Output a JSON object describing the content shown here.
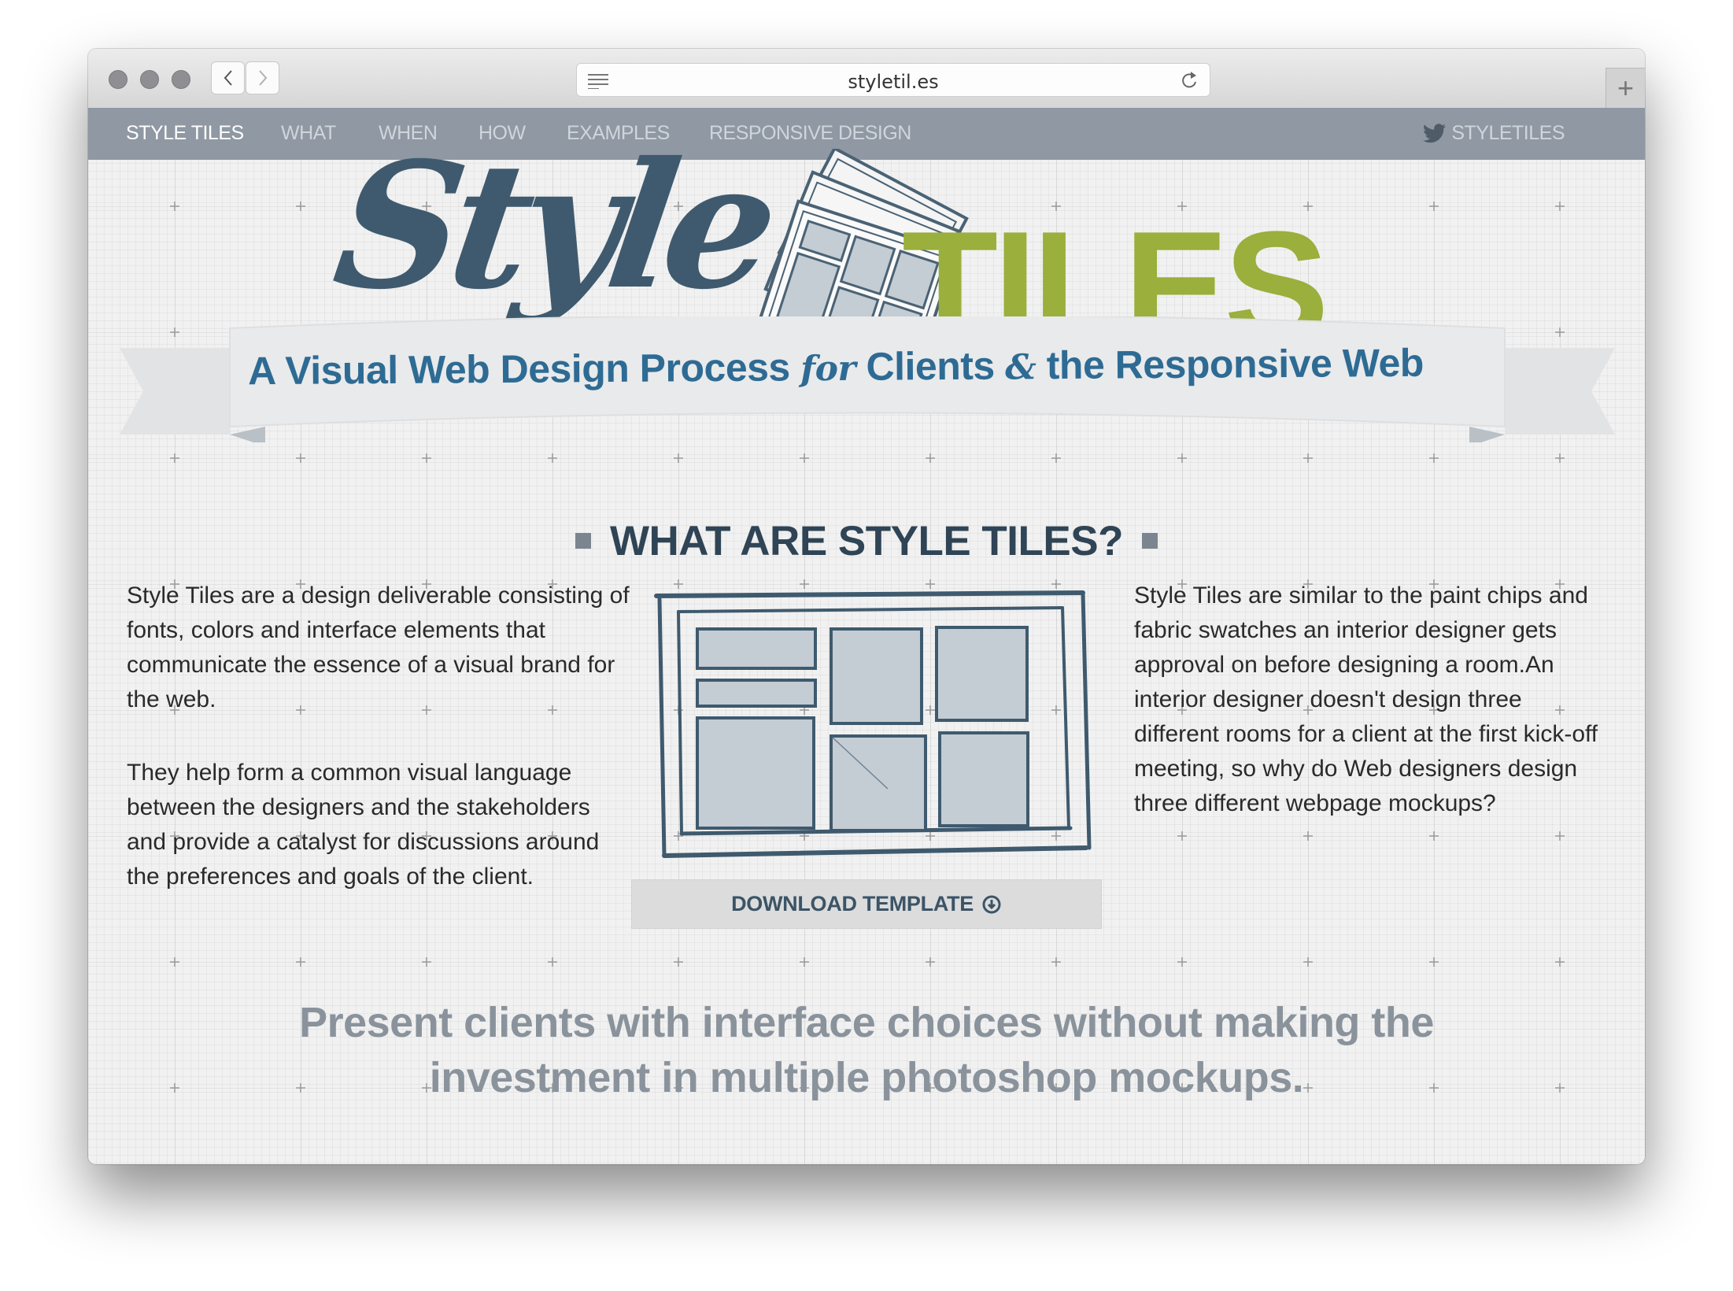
{
  "browser": {
    "url": "styletil.es",
    "traffic_lights": [
      "close",
      "minimize",
      "zoom"
    ],
    "new_tab_label": "+"
  },
  "site_nav": {
    "items": [
      {
        "label": "STYLE TILES",
        "active": true
      },
      {
        "label": "WHAT",
        "active": false
      },
      {
        "label": "WHEN",
        "active": false
      },
      {
        "label": "HOW",
        "active": false
      },
      {
        "label": "EXAMPLES",
        "active": false
      },
      {
        "label": "RESPONSIVE DESIGN",
        "active": false
      }
    ],
    "twitter_label": "STYLETILES"
  },
  "logo": {
    "script_word": "Style",
    "block_word": "TILES",
    "colors": {
      "script": "#3f5a6e",
      "block": "#9aaf3c"
    }
  },
  "ribbon": {
    "part1": "A Visual Web Design Process",
    "for": "for",
    "part2": "Clients",
    "amp": "&",
    "part3": "the Responsive Web"
  },
  "section": {
    "heading": "WHAT ARE STYLE TILES?",
    "left_paragraphs": [
      "Style Tiles are a design deliverable consisting of fonts, colors and interface elements that communicate the essence of a visual brand for the web.",
      "They help form a common visual language between the designers and the stakeholders and provide a catalyst for discussions around the preferences and goals of the client."
    ],
    "right_paragraphs": [
      "Style Tiles are similar to the paint chips and fabric swatches an interior designer gets approval on before designing a room.An interior designer doesn't design three different rooms for a client at the first kick-off meeting, so why do Web designers design three different webpage mockups?"
    ],
    "download_button": "DOWNLOAD TEMPLATE"
  },
  "tagline": "Present clients with interface choices without making the investment in multiple photoshop mockups.",
  "colors": {
    "nav_bg": "#8f98a3",
    "heading": "#2f4455",
    "ribbon_text": "#2e6b94",
    "tagline": "#8a939c"
  }
}
